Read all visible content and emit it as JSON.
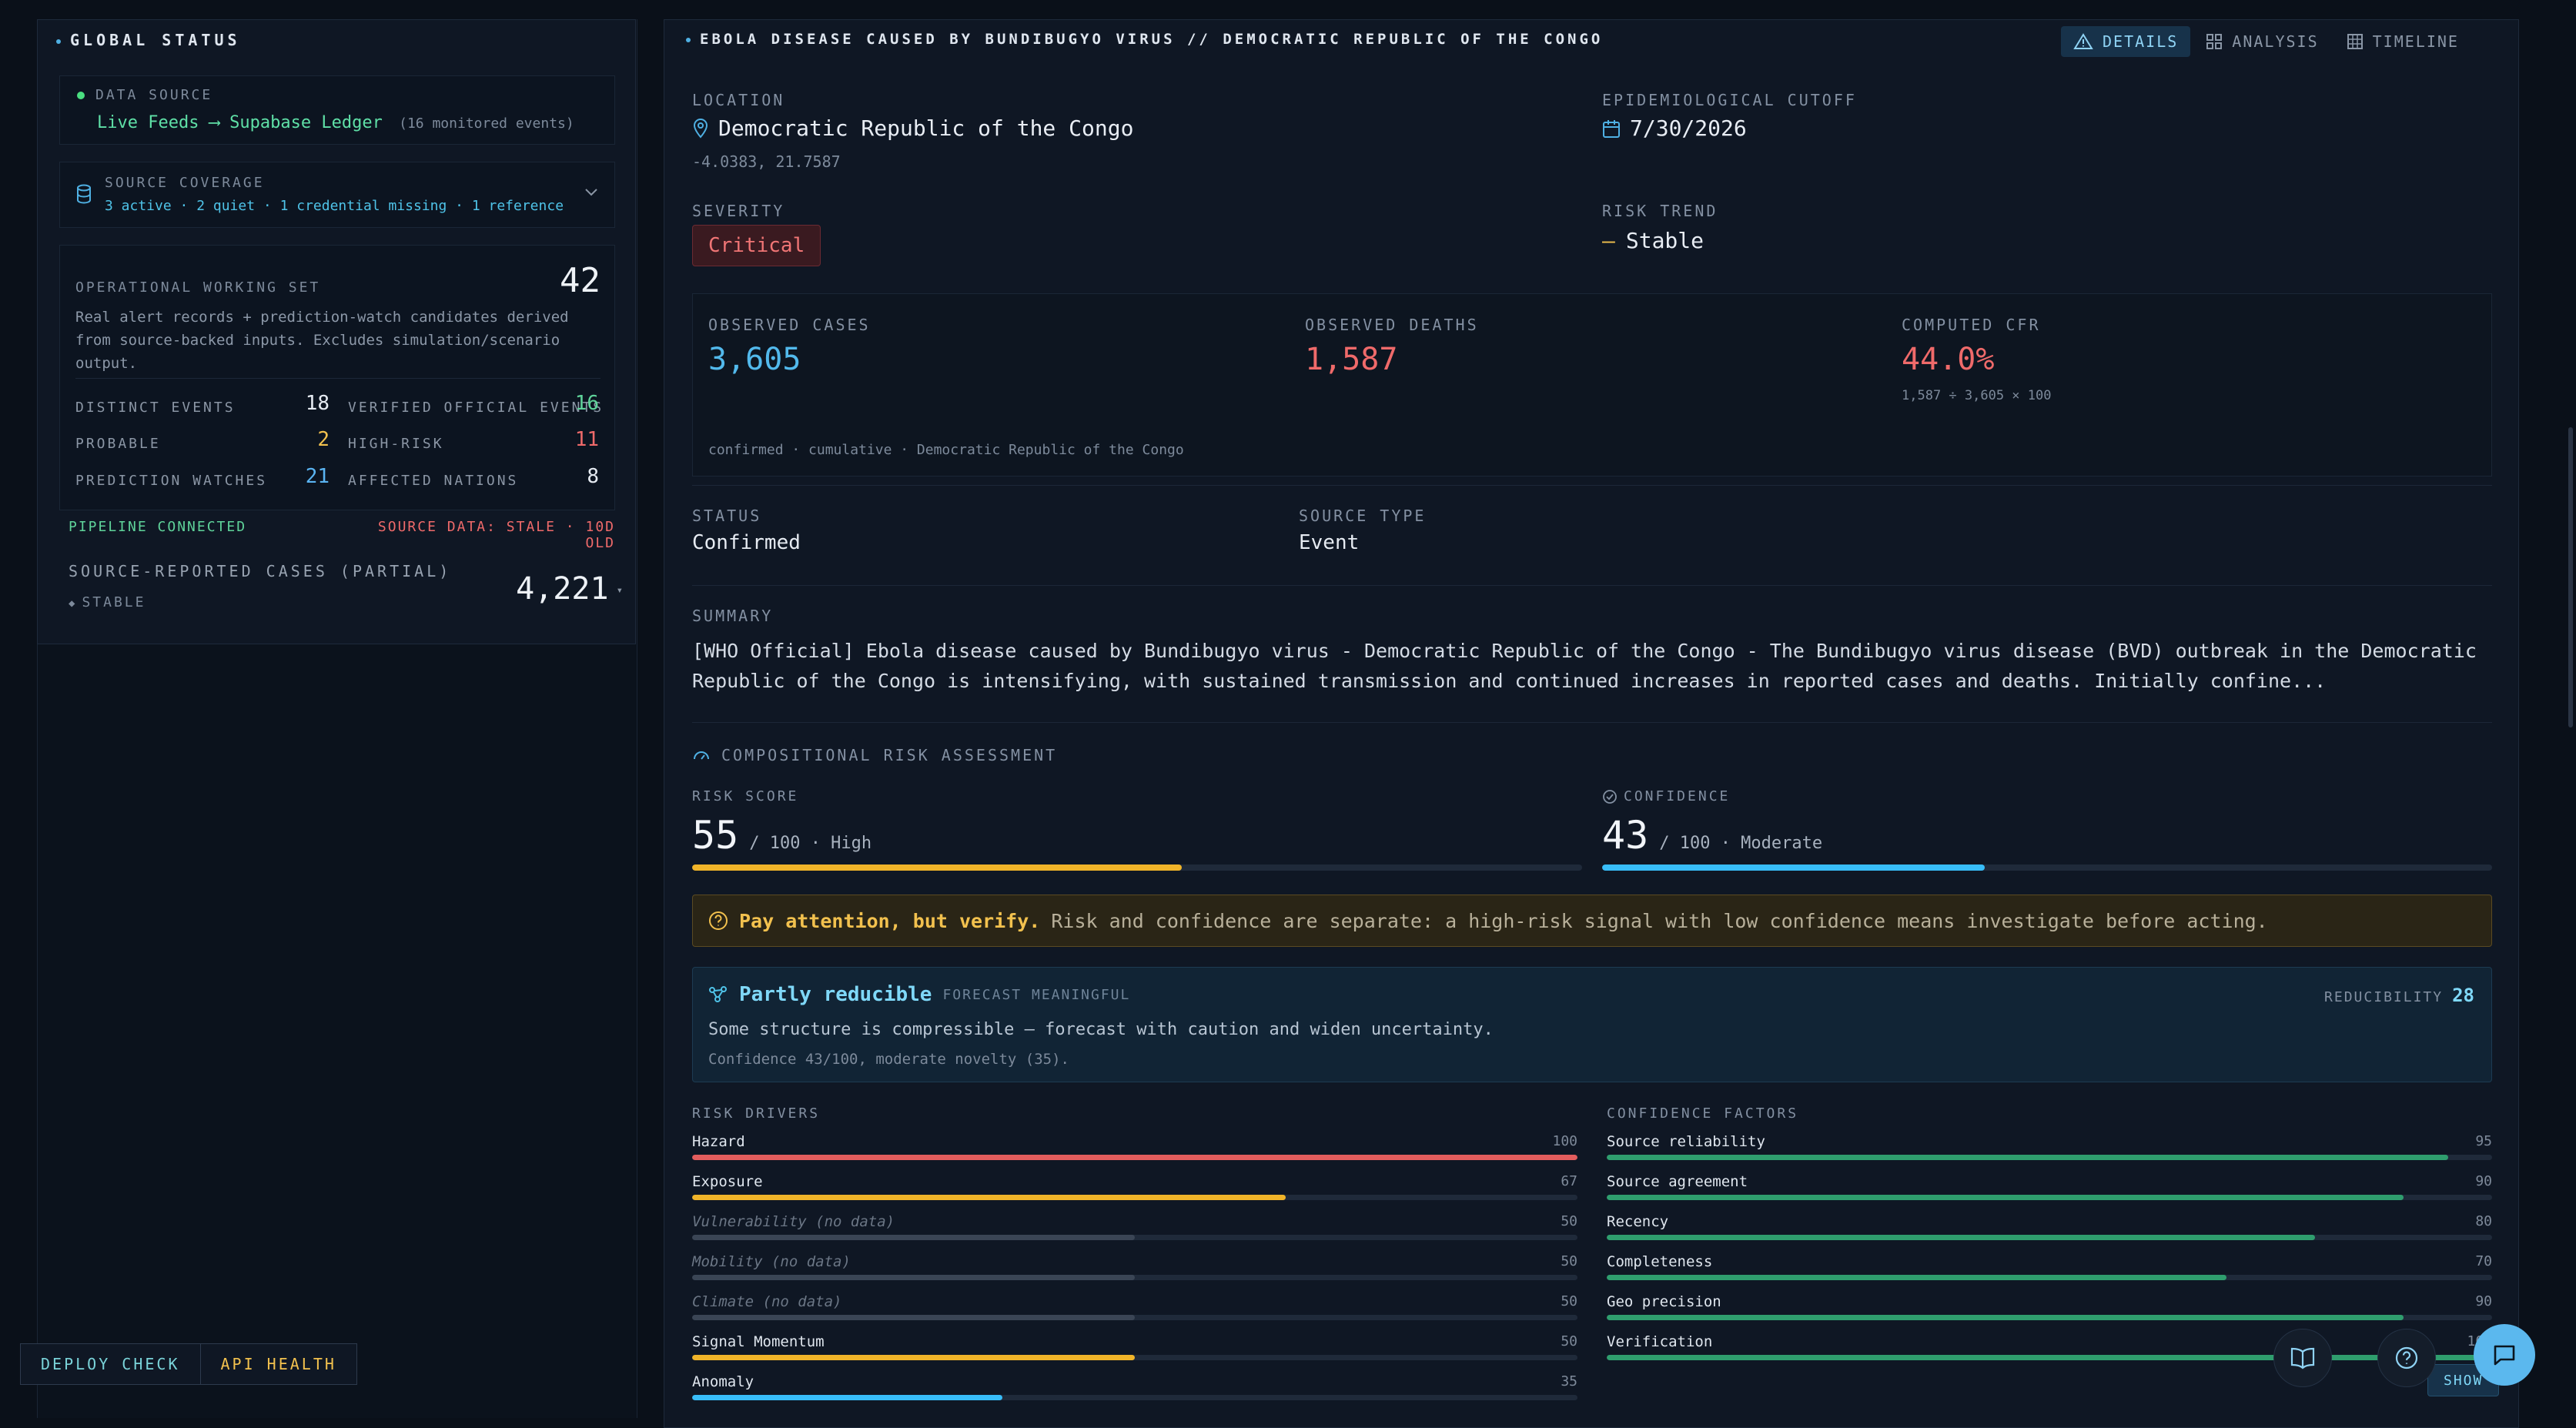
{
  "global_status": {
    "title": "GLOBAL STATUS",
    "data_source": {
      "label": "DATA SOURCE",
      "value": "Live Feeds ⟶ Supabase Ledger",
      "note": "(16 monitored events)"
    },
    "source_coverage": {
      "label": "SOURCE COVERAGE",
      "summary": "3 active · 2 quiet · 1 credential missing · 1 reference"
    },
    "working_set": {
      "label": "OPERATIONAL WORKING SET",
      "count": "42",
      "description": "Real alert records + prediction-watch candidates derived from source-backed inputs. Excludes simulation/scenario output."
    },
    "stats": [
      {
        "label": "DISTINCT EVENTS",
        "value": "18",
        "color": "#e6ebf2"
      },
      {
        "label": "VERIFIED OFFICIAL EVENTS",
        "value": "16",
        "color": "#5fd39a"
      },
      {
        "label": "PROBABLE",
        "value": "2",
        "color": "#f2c14e"
      },
      {
        "label": "HIGH-RISK",
        "value": "11",
        "color": "#ef6a6a"
      },
      {
        "label": "PREDICTION WATCHES",
        "value": "21",
        "color": "#5ab4f2"
      },
      {
        "label": "AFFECTED NATIONS",
        "value": "8",
        "color": "#e6ebf2"
      }
    ],
    "pipeline": "PIPELINE CONNECTED",
    "stale": "SOURCE DATA: STALE · 10D OLD",
    "cases_label": "SOURCE-REPORTED CASES (PARTIAL)",
    "cases_value": "4,221",
    "cases_trend": "STABLE"
  },
  "footer_buttons": {
    "deploy": "DEPLOY CHECK",
    "api": "API HEALTH"
  },
  "detail": {
    "title": "EBOLA DISEASE CAUSED BY BUNDIBUGYO VIRUS // DEMOCRATIC REPUBLIC OF THE CONGO",
    "tabs": [
      {
        "label": "DETAILS",
        "icon": "alert-triangle-icon"
      },
      {
        "label": "ANALYSIS",
        "icon": "grid-icon"
      },
      {
        "label": "TIMELINE",
        "icon": "calendar-grid-icon"
      }
    ],
    "location_label": "LOCATION",
    "location": "Democratic Republic of the Congo",
    "coords": "-4.0383, 21.7587",
    "cutoff_label": "EPIDEMIOLOGICAL CUTOFF",
    "cutoff": "7/30/2026",
    "severity_label": "SEVERITY",
    "severity": "Critical",
    "trend_label": "RISK TREND",
    "trend_symbol": "—",
    "trend": "Stable",
    "observed_cases_label": "OBSERVED CASES",
    "observed_cases": "3,605",
    "observed_deaths_label": "OBSERVED DEATHS",
    "observed_deaths": "1,587",
    "cfr_label": "COMPUTED CFR",
    "cfr": "44.0%",
    "cfr_formula": "1,587 ÷ 3,605 × 100",
    "counts_note": "confirmed · cumulative · Democratic Republic of the Congo",
    "status_label": "STATUS",
    "status": "Confirmed",
    "source_type_label": "SOURCE TYPE",
    "source_type": "Event",
    "summary_label": "SUMMARY",
    "summary": "[WHO Official] Ebola disease caused by Bundibugyo virus - Democratic Republic of the Congo - The Bundibugyo virus disease (BVD) outbreak in the Democratic Republic of the Congo is intensifying, with sustained transmission and continued increases in reported cases and deaths. Initially confine...",
    "assessment_label": "COMPOSITIONAL RISK ASSESSMENT",
    "risk_score_label": "RISK SCORE",
    "risk_score": "55",
    "risk_score_suffix": "/ 100 · High",
    "risk_score_fraction": 0.55,
    "confidence_label": "CONFIDENCE",
    "confidence": "43",
    "confidence_suffix": "/ 100 · Moderate",
    "confidence_fraction": 0.43,
    "alert_bold": "Pay attention, but verify.",
    "alert_text": "Risk and confidence are separate: a high-risk signal with low confidence means investigate before acting.",
    "reducible_title": "Partly reducible",
    "reducible_tag": "FORECAST MEANINGFUL",
    "reducibility_label": "REDUCIBILITY",
    "reducibility": "28",
    "reducible_text": "Some structure is compressible — forecast with caution and widen uncertainty.",
    "reducible_note": "Confidence 43/100, moderate novelty (35).",
    "drivers_label": "RISK DRIVERS",
    "drivers": [
      {
        "label": "Hazard",
        "value": 100,
        "color": "#e35d5d",
        "nodata": false
      },
      {
        "label": "Exposure",
        "value": 67,
        "color": "#f0b429",
        "nodata": false
      },
      {
        "label": "Vulnerability (no data)",
        "value": 50,
        "color": "#3a4555",
        "nodata": true
      },
      {
        "label": "Mobility (no data)",
        "value": 50,
        "color": "#3a4555",
        "nodata": true
      },
      {
        "label": "Climate (no data)",
        "value": 50,
        "color": "#3a4555",
        "nodata": true
      },
      {
        "label": "Signal Momentum",
        "value": 50,
        "color": "#f0b429",
        "nodata": false
      },
      {
        "label": "Anomaly",
        "value": 35,
        "color": "#38bdf8",
        "nodata": false
      }
    ],
    "factors_label": "CONFIDENCE FACTORS",
    "factors": [
      {
        "label": "Source reliability",
        "value": 95,
        "color": "#2f9e6e"
      },
      {
        "label": "Source agreement",
        "value": 90,
        "color": "#2f9e6e"
      },
      {
        "label": "Recency",
        "value": 80,
        "color": "#2f9e6e"
      },
      {
        "label": "Completeness",
        "value": 70,
        "color": "#2f9e6e"
      },
      {
        "label": "Geo precision",
        "value": 90,
        "color": "#2f9e6e"
      },
      {
        "label": "Verification",
        "value": 100,
        "color": "#2f9e6e"
      }
    ],
    "show_more": "SHOW"
  }
}
